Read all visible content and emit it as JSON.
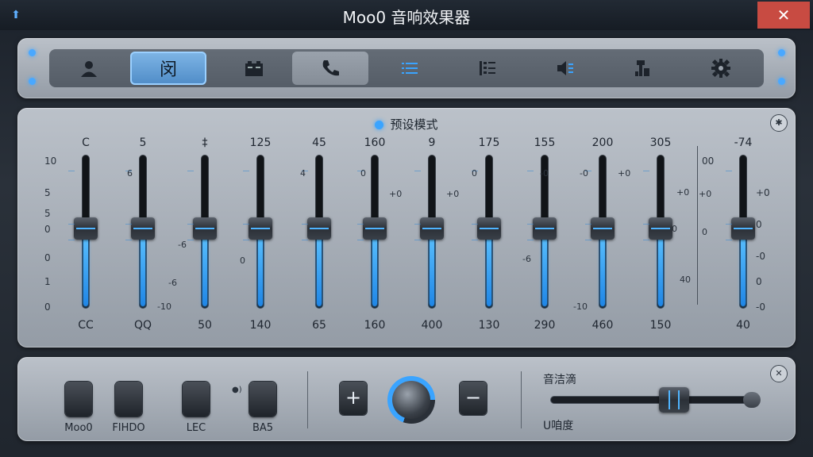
{
  "window": {
    "title": "Moo0 音响效果器",
    "close_glyph": "✕"
  },
  "toolbar": {
    "tabs": [
      {
        "icon": "user-icon"
      },
      {
        "icon": "text-glyph-icon",
        "glyph": "闵",
        "state": "selected"
      },
      {
        "icon": "battery-icon"
      },
      {
        "icon": "phone-icon",
        "state": "pressed"
      },
      {
        "icon": "list-icon"
      },
      {
        "icon": "checklist-icon"
      },
      {
        "icon": "speaker-icon"
      },
      {
        "icon": "device-icon"
      },
      {
        "icon": "gear-icon"
      }
    ]
  },
  "equalizer": {
    "preset_label": "预设模式",
    "accent": "#3aa4ff",
    "bands": [
      {
        "top": "C",
        "bottom": "CC",
        "level": 0.52
      },
      {
        "top": "5",
        "bottom": "QQ",
        "level": 0.52
      },
      {
        "top": "‡",
        "bottom": "50",
        "level": 0.52
      },
      {
        "top": "125",
        "bottom": "140",
        "level": 0.52
      },
      {
        "top": "45",
        "bottom": "65",
        "level": 0.52
      },
      {
        "top": "160",
        "bottom": "160",
        "level": 0.52
      },
      {
        "top": "9",
        "bottom": "400",
        "level": 0.52
      },
      {
        "top": "175",
        "bottom": "130",
        "level": 0.52
      },
      {
        "top": "155",
        "bottom": "290",
        "level": 0.52
      },
      {
        "top": "200",
        "bottom": "460",
        "level": 0.52
      },
      {
        "top": "305",
        "bottom": "150",
        "level": 0.52
      },
      {
        "top": "-74",
        "bottom": "40",
        "level": 0.52
      }
    ],
    "left_scale": [
      "10",
      "5",
      "5",
      "0",
      "0",
      "1",
      "0"
    ],
    "right_scale": [
      "00",
      "+0",
      "0",
      "-0",
      "0",
      "-0"
    ],
    "inline_labels": [
      "6",
      "-6",
      "0",
      "-6",
      "4",
      "0",
      "+0",
      "+0",
      "0",
      "-0",
      "-6",
      "-0",
      "-10",
      "-10",
      "+0",
      "+0",
      "40",
      "0",
      "+0",
      "0"
    ]
  },
  "controls": {
    "buttons": [
      {
        "label": "Moo0"
      },
      {
        "label": "FIHDO"
      },
      {
        "label": "LEC"
      },
      {
        "label": "BA5"
      }
    ],
    "plus": "+",
    "minus": "−",
    "volume_label": "音洁滴",
    "bottom_label": "U咱度",
    "volume_level": 0.62
  }
}
